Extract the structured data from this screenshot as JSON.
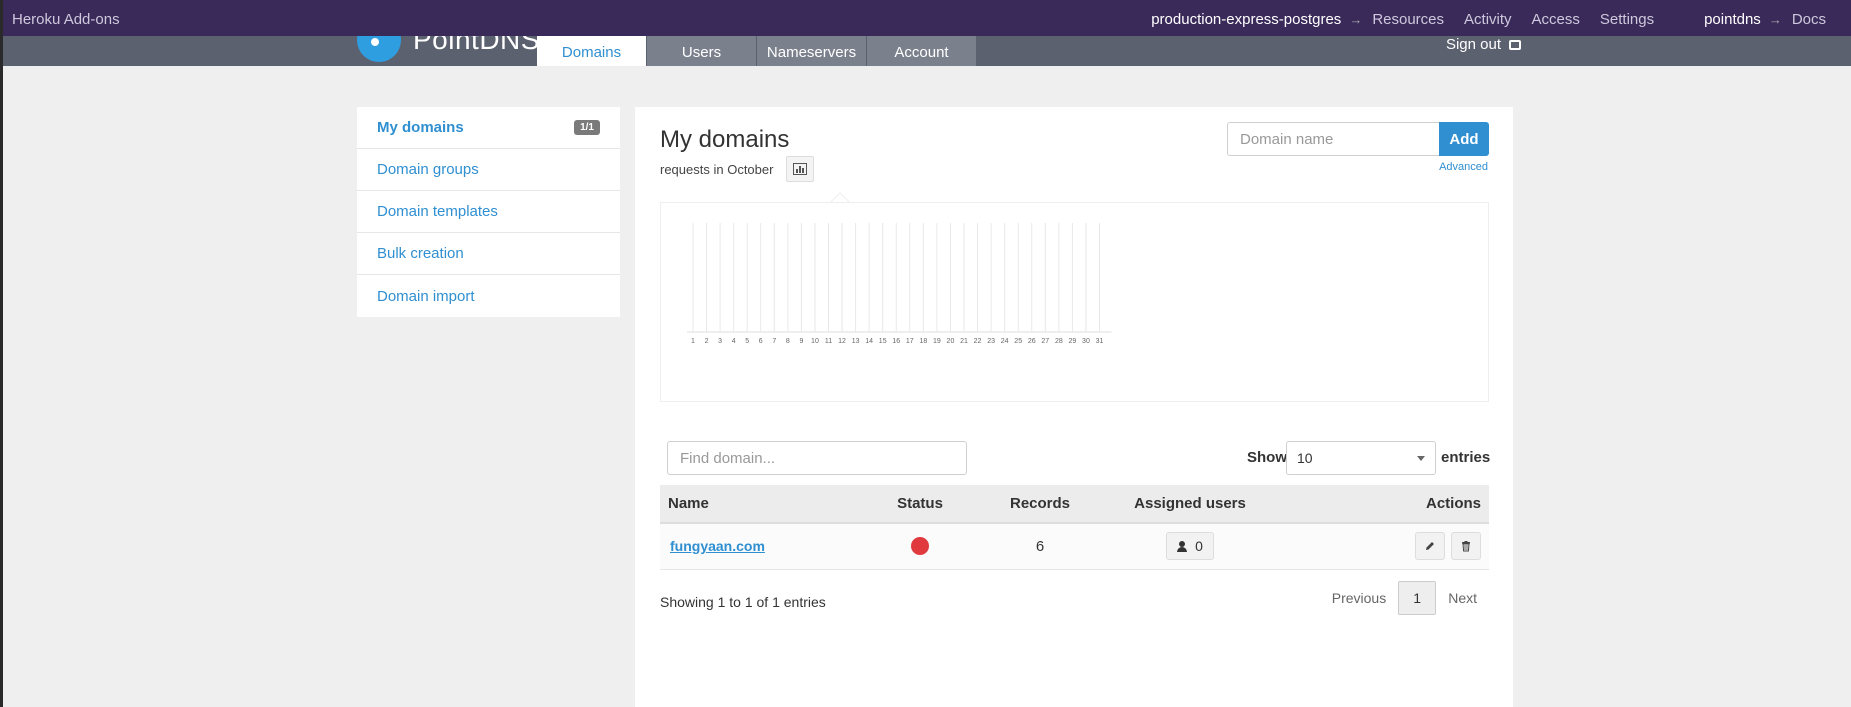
{
  "heroku": {
    "brand": "Heroku Add-ons",
    "app": "production-express-postgres",
    "arrow": "→",
    "links": [
      "Resources",
      "Activity",
      "Access",
      "Settings"
    ],
    "addon": "pointdns",
    "docs": "Docs"
  },
  "app": {
    "logo_text": "PointDNS",
    "tabs": [
      "Domains",
      "Users",
      "Nameservers",
      "Account"
    ],
    "active_tab": "Domains",
    "sign_out": "Sign out"
  },
  "sidebar": {
    "items": [
      {
        "label": "My domains",
        "badge": "1/1"
      },
      {
        "label": "Domain groups"
      },
      {
        "label": "Domain templates"
      },
      {
        "label": "Bulk creation"
      },
      {
        "label": "Domain import"
      }
    ]
  },
  "main": {
    "title": "My domains",
    "subtitle": "requests in October",
    "domain_input_placeholder": "Domain name",
    "add_label": "Add",
    "advanced_label": "Advanced"
  },
  "chart_data": {
    "type": "bar",
    "categories": [
      "1",
      "2",
      "3",
      "4",
      "5",
      "6",
      "7",
      "8",
      "9",
      "10",
      "11",
      "12",
      "13",
      "14",
      "15",
      "16",
      "17",
      "18",
      "19",
      "20",
      "21",
      "22",
      "23",
      "24",
      "25",
      "26",
      "27",
      "28",
      "29",
      "30",
      "31"
    ],
    "values": [
      0,
      0,
      0,
      0,
      0,
      0,
      0,
      0,
      0,
      0,
      0,
      0,
      0,
      0,
      0,
      0,
      0,
      0,
      0,
      0,
      0,
      0,
      0,
      0,
      0,
      0,
      0,
      0,
      0,
      0,
      0
    ]
  },
  "table": {
    "find_placeholder": "Find domain...",
    "show_label": "Show",
    "page_size": "10",
    "entries_label": "entries",
    "columns": [
      "Name",
      "Status",
      "Records",
      "Assigned users",
      "Actions"
    ],
    "rows": [
      {
        "name": "fungyaan.com",
        "status": "red",
        "records": "6",
        "users": "0"
      }
    ],
    "showing": "Showing 1 to 1 of 1 entries",
    "previous": "Previous",
    "current_page": "1",
    "next": "Next"
  },
  "colors": {
    "heroku_bar": "#3a2a5a",
    "nav_bar": "#5c6170",
    "accent": "#2f8fd1",
    "status_red": "#e0393e"
  }
}
